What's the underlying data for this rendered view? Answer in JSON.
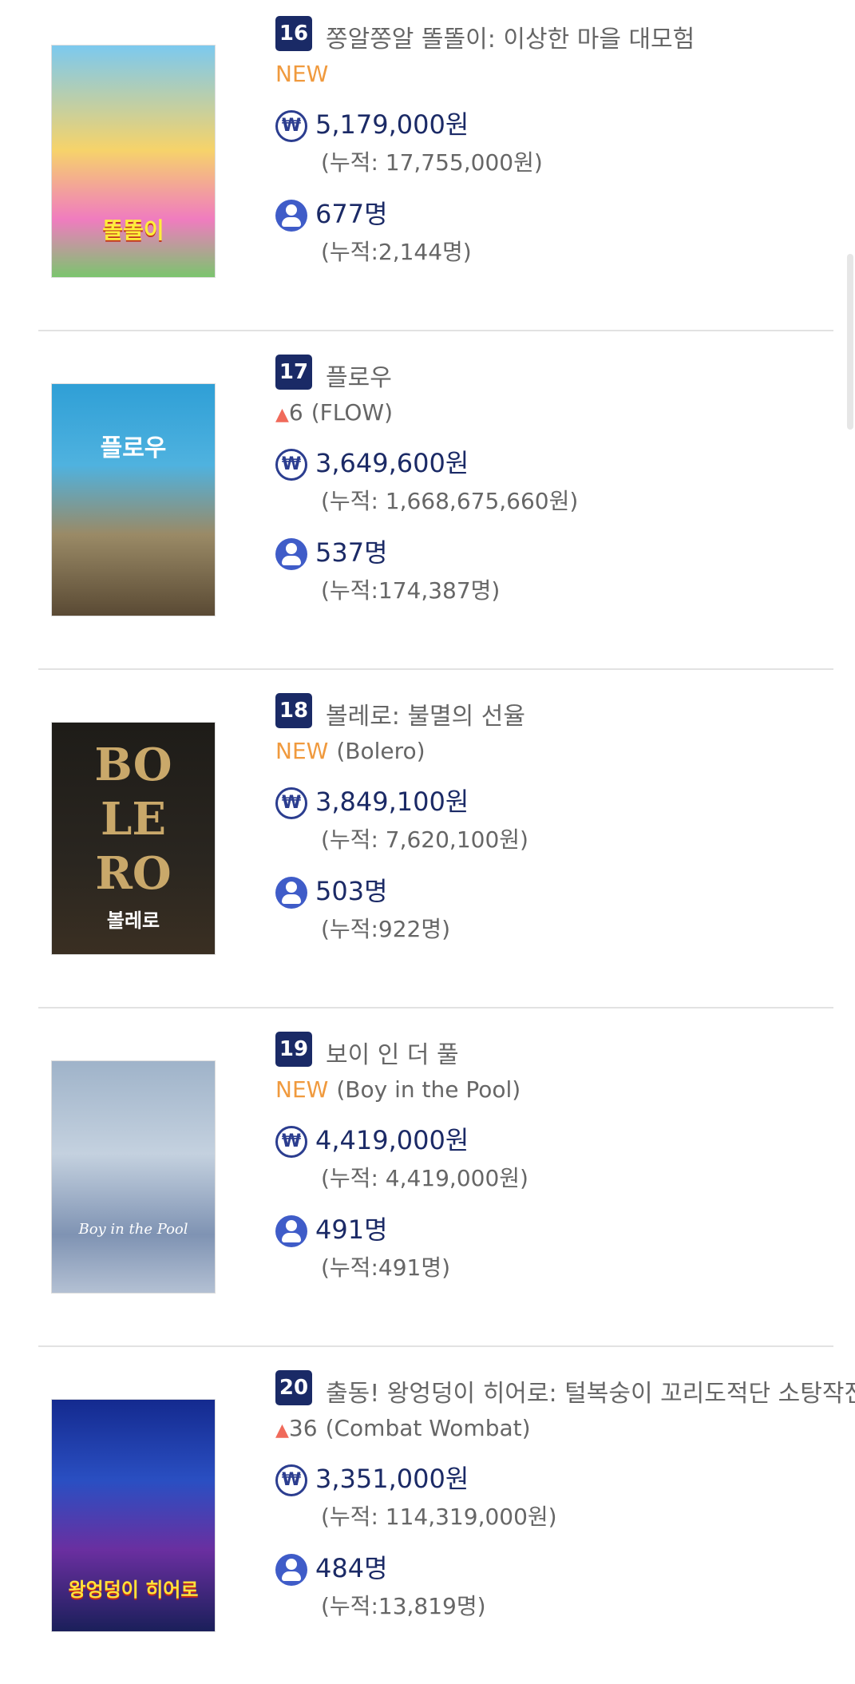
{
  "labels": {
    "new": "NEW"
  },
  "movies": [
    {
      "rank": "16",
      "title": "쫑알쫑알 똘똘이: 이상한 마을 대모험",
      "status": "NEW",
      "original_title": "",
      "revenue": "5,179,000원",
      "revenue_cumulative": "(누적: 17,755,000원)",
      "audience": "677명",
      "audience_cumulative": "(누적:2,144명)",
      "poster_colors": [
        "#6ec4e8",
        "#f2b64a"
      ]
    },
    {
      "rank": "17",
      "title": "플로우",
      "status": "6",
      "original_title": "(FLOW)",
      "revenue": "3,649,600원",
      "revenue_cumulative": "(누적: 1,668,675,660원)",
      "audience": "537명",
      "audience_cumulative": "(누적:174,387명)",
      "poster_colors": [
        "#3aa6d8",
        "#8a7a5c"
      ]
    },
    {
      "rank": "18",
      "title": "볼레로: 불멸의 선율",
      "status": "NEW",
      "original_title": "(Bolero)",
      "revenue": "3,849,100원",
      "revenue_cumulative": "(누적: 7,620,100원)",
      "audience": "503명",
      "audience_cumulative": "(누적:922명)",
      "poster_colors": [
        "#1c1a16",
        "#c9a86a"
      ]
    },
    {
      "rank": "19",
      "title": "보이 인 더 풀",
      "status": "NEW",
      "original_title": "(Boy in the Pool)",
      "revenue": "4,419,000원",
      "revenue_cumulative": "(누적: 4,419,000원)",
      "audience": "491명",
      "audience_cumulative": "(누적:491명)",
      "poster_colors": [
        "#8fa6c4",
        "#dfe6ef"
      ]
    },
    {
      "rank": "20",
      "title": "출동! 왕엉덩이 히어로: 털복숭이 꼬리도적단 소탕작전",
      "status": "36",
      "original_title": "(Combat Wombat)",
      "revenue": "3,351,000원",
      "revenue_cumulative": "(누적: 114,319,000원)",
      "audience": "484명",
      "audience_cumulative": "(누적:13,819명)",
      "poster_colors": [
        "#1b2a8a",
        "#e0402e"
      ]
    }
  ],
  "posters": {
    "p16": "똘똘이",
    "p17": "플로우",
    "p18a": "BO",
    "p18b": "LE",
    "p18c": "RO",
    "p18d": "볼레로",
    "p19": "Boy in the Pool",
    "p20": "왕엉덩이 히어로"
  },
  "icons": {
    "revenue": "won-icon",
    "audience": "person-icon"
  },
  "colors": {
    "rank_bg": "#1a2a66",
    "new": "#f09a3e",
    "up": "#f06a5a",
    "value": "#1b2a66"
  }
}
